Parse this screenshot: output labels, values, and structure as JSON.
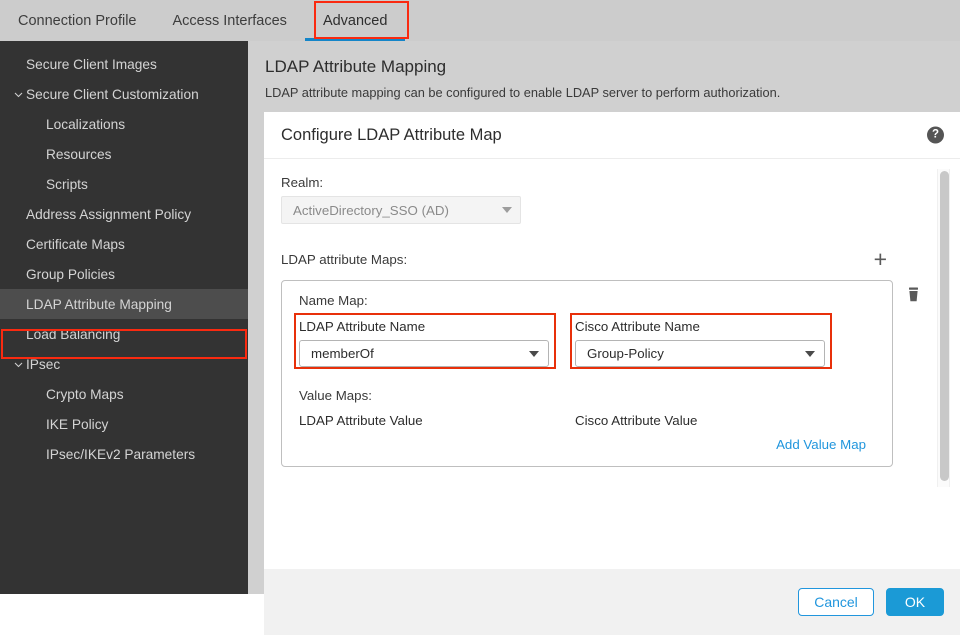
{
  "tabs": [
    {
      "label": "Connection Profile",
      "active": false
    },
    {
      "label": "Access Interfaces",
      "active": false
    },
    {
      "label": "Advanced",
      "active": true
    }
  ],
  "sidebar": {
    "items": [
      {
        "label": "Secure Client Images",
        "level": 0,
        "chevron": "",
        "selected": false
      },
      {
        "label": "Secure Client Customization",
        "level": 0,
        "chevron": "down",
        "selected": false
      },
      {
        "label": "Localizations",
        "level": 1,
        "chevron": "",
        "selected": false
      },
      {
        "label": "Resources",
        "level": 1,
        "chevron": "",
        "selected": false
      },
      {
        "label": "Scripts",
        "level": 1,
        "chevron": "",
        "selected": false
      },
      {
        "label": "Address Assignment Policy",
        "level": 0,
        "chevron": "",
        "selected": false
      },
      {
        "label": "Certificate Maps",
        "level": 0,
        "chevron": "",
        "selected": false
      },
      {
        "label": "Group Policies",
        "level": 0,
        "chevron": "",
        "selected": false
      },
      {
        "label": "LDAP Attribute Mapping",
        "level": 0,
        "chevron": "",
        "selected": true
      },
      {
        "label": "Load Balancing",
        "level": 0,
        "chevron": "",
        "selected": false
      },
      {
        "label": "IPsec",
        "level": 0,
        "chevron": "down",
        "selected": false
      },
      {
        "label": "Crypto Maps",
        "level": 1,
        "chevron": "",
        "selected": false
      },
      {
        "label": "IKE Policy",
        "level": 1,
        "chevron": "",
        "selected": false
      },
      {
        "label": "IPsec/IKEv2 Parameters",
        "level": 1,
        "chevron": "",
        "selected": false
      }
    ]
  },
  "page": {
    "title": "LDAP Attribute Mapping",
    "subtitle": "LDAP attribute mapping can be configured to enable LDAP server to perform authorization."
  },
  "card": {
    "title": "Configure LDAP Attribute Map",
    "help_icon": "question-mark-icon",
    "realm": {
      "label": "Realm:",
      "value": "ActiveDirectory_SSO (AD)"
    },
    "attribute_maps": {
      "label": "LDAP attribute Maps:",
      "add_icon": "plus-icon",
      "delete_icon": "trash-icon"
    },
    "name_map": {
      "label": "Name Map:",
      "ldap_attribute": {
        "header": "LDAP Attribute Name",
        "value": "memberOf"
      },
      "cisco_attribute": {
        "header": "Cisco Attribute Name",
        "value": "Group-Policy"
      }
    },
    "value_maps": {
      "label": "Value Maps:",
      "ldap_header": "LDAP Attribute Value",
      "cisco_header": "Cisco Attribute Value",
      "add_link": "Add Value Map"
    }
  },
  "footer": {
    "cancel": "Cancel",
    "ok": "OK"
  },
  "colors": {
    "accent_blue": "#1b9ad6",
    "link_blue": "#2196dd",
    "annotation_red": "#fa2a10",
    "sidebar_bg": "#333333",
    "page_bg": "#d0d0d0"
  }
}
